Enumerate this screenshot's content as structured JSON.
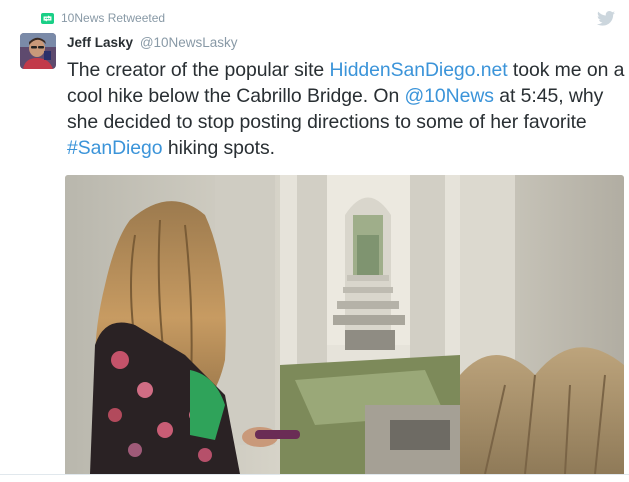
{
  "retweet": {
    "label": "10News Retweeted"
  },
  "author": {
    "name": "Jeff Lasky",
    "handle": "@10NewsLasky"
  },
  "tweet": {
    "part1": "The creator of the popular site ",
    "link1": "HiddenSanDiego.net",
    "part2": " took me on a cool hike below the Cabrillo Bridge. On ",
    "mention": "@10News",
    "part3": " at 5:45, why she decided to stop posting directions to some of her favorite ",
    "hashtag": "#SanDiego",
    "part4": " hiking spots."
  },
  "media": {
    "description": "Photo: woman with long hair looking down a corridor of concrete arches beneath the bridge"
  },
  "colors": {
    "link": "#3b94d9",
    "retweet_icon": "#19cf86",
    "bird": "#ccd6dd",
    "muted": "#8899a6"
  },
  "icons": {
    "retweet": "retweet-icon",
    "twitter": "twitter-bird-icon"
  }
}
